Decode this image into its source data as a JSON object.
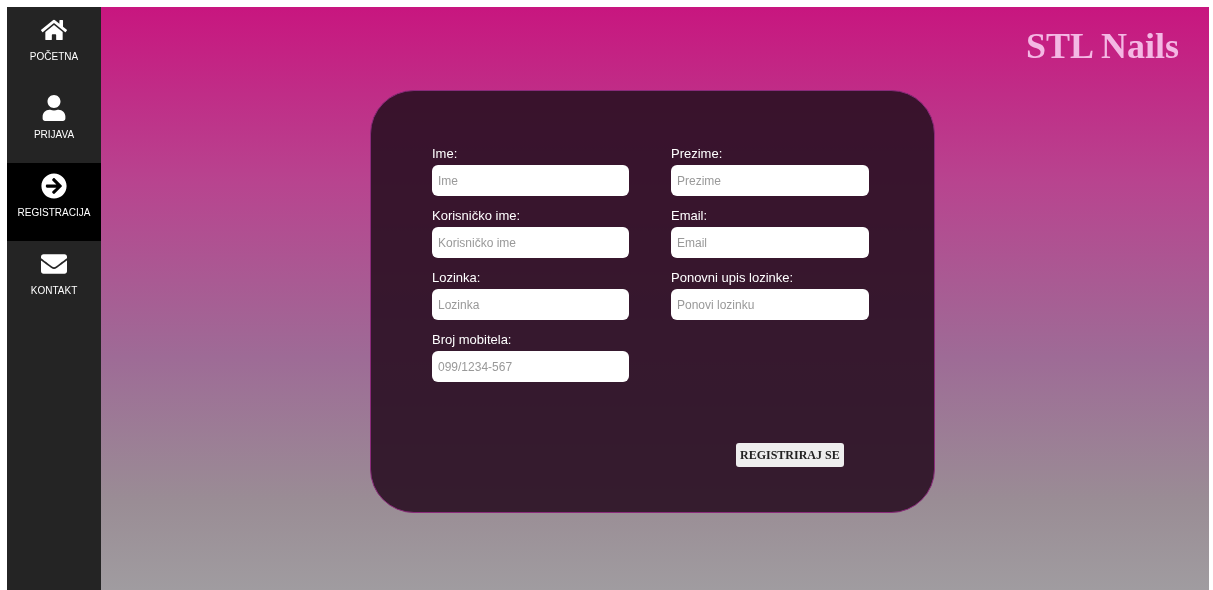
{
  "sidebar": {
    "items": [
      {
        "label": "POČETNA",
        "selected": false
      },
      {
        "label": "PRIJAVA",
        "selected": false
      },
      {
        "label": "REGISTRACIJA",
        "selected": true
      },
      {
        "label": "KONTAKT",
        "selected": false
      }
    ]
  },
  "logo": "STL Nails",
  "form": {
    "fields": [
      {
        "label": "Ime:",
        "placeholder": "Ime"
      },
      {
        "label": "Prezime:",
        "placeholder": "Prezime"
      },
      {
        "label": "Korisničko ime:",
        "placeholder": "Korisničko ime"
      },
      {
        "label": "Email:",
        "placeholder": "Email"
      },
      {
        "label": "Lozinka:",
        "placeholder": "Lozinka"
      },
      {
        "label": "Ponovni upis lozinke:",
        "placeholder": "Ponovi lozinku"
      },
      {
        "label": "Broj mobitela:",
        "placeholder": "099/1234-567"
      }
    ],
    "submit": "REGISTRIRAJ SE"
  }
}
